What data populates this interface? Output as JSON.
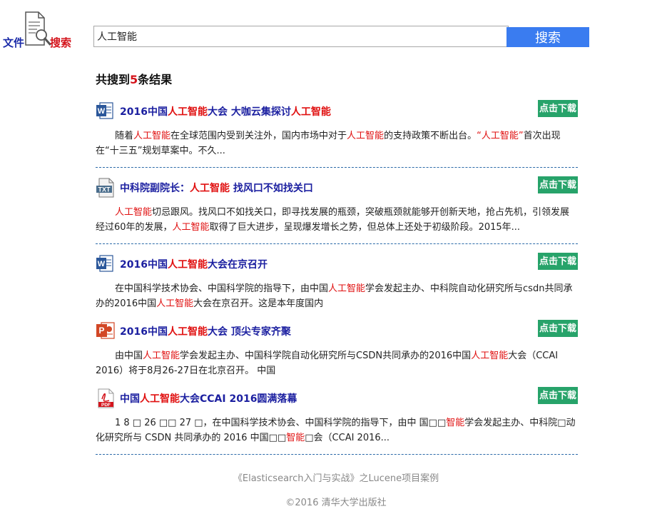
{
  "logo": {
    "left_text": "文件",
    "right_text": "搜索"
  },
  "search": {
    "value": "人工智能",
    "button_label": "搜索"
  },
  "summary": {
    "prefix": "共搜到",
    "count": "5",
    "suffix": "条结果"
  },
  "results": [
    {
      "filetype": "word-icon",
      "title": [
        {
          "t": "2016中国",
          "hl": false
        },
        {
          "t": "人工智能",
          "hl": true
        },
        {
          "t": "大会 大咖云集探讨",
          "hl": false
        },
        {
          "t": "人工智能",
          "hl": true
        }
      ],
      "download_label": "点击下载",
      "snippet": [
        {
          "t": "随着",
          "hl": false
        },
        {
          "t": "人工智能",
          "hl": true
        },
        {
          "t": "在全球范围内受到关注外，国内市场中对于",
          "hl": false
        },
        {
          "t": "人工智能",
          "hl": true
        },
        {
          "t": "的支持政策不断出台。",
          "hl": false
        },
        {
          "t": "“人工智能”",
          "hl": true
        },
        {
          "t": "首次出现在“十三五”规划草案中。不久...",
          "hl": false
        }
      ],
      "separator": true
    },
    {
      "filetype": "txt-icon",
      "title": [
        {
          "t": "中科院副院长：",
          "hl": false
        },
        {
          "t": "人工智能",
          "hl": true
        },
        {
          "t": " 找风口不如找关口",
          "hl": false
        }
      ],
      "download_label": "点击下载",
      "snippet": [
        {
          "t": "人工智能",
          "hl": true
        },
        {
          "t": "切忌跟风。找风口不如找关口，即寻找发展的瓶颈，突破瓶颈就能够开创新天地，抢占先机，引领发展 经过60年的发展，",
          "hl": false
        },
        {
          "t": "人工智能",
          "hl": true
        },
        {
          "t": "取得了巨大进步，呈现爆发增长之势，但总体上还处于初级阶段。2015年...",
          "hl": false
        }
      ],
      "separator": true
    },
    {
      "filetype": "word-icon",
      "title": [
        {
          "t": "2016中国",
          "hl": false
        },
        {
          "t": "人工智能",
          "hl": true
        },
        {
          "t": "大会在京召开",
          "hl": false
        }
      ],
      "download_label": "点击下载",
      "snippet": [
        {
          "t": "在中国科学技术协会、中国科学院的指导下，由中国",
          "hl": false
        },
        {
          "t": "人工智能",
          "hl": true
        },
        {
          "t": "学会发起主办、中科院自动化研究所与csdn共同承办的2016中国",
          "hl": false
        },
        {
          "t": "人工智能",
          "hl": true
        },
        {
          "t": "大会在京召开。这是本年度国内",
          "hl": false
        }
      ],
      "separator": false
    },
    {
      "filetype": "ppt-icon",
      "title": [
        {
          "t": "2016中国",
          "hl": false
        },
        {
          "t": "人工智能",
          "hl": true
        },
        {
          "t": "大会 顶尖专家齐聚",
          "hl": false
        }
      ],
      "download_label": "点击下载",
      "snippet": [
        {
          "t": "由中国",
          "hl": false
        },
        {
          "t": "人工智能",
          "hl": true
        },
        {
          "t": "学会发起主办、中国科学院自动化研究所与CSDN共同承办的2016中国",
          "hl": false
        },
        {
          "t": "人工智能",
          "hl": true
        },
        {
          "t": "大会（CCAI 2016）将于8月26-27日在北京召开。 中国",
          "hl": false
        }
      ],
      "separator": false
    },
    {
      "filetype": "pdf-icon",
      "title": [
        {
          "t": "中国",
          "hl": false
        },
        {
          "t": "人工智能",
          "hl": true
        },
        {
          "t": "大会CCAI 2016圆满落幕",
          "hl": false
        }
      ],
      "download_label": "点击下载",
      "snippet": [
        {
          "t": "1 8 □ 26 □□ 27 □，在中国科学技术协会、中国科学院的指导下，由中 国□□",
          "hl": false
        },
        {
          "t": "智能",
          "hl": true
        },
        {
          "t": "学会发起主办、中科院□动化研究所与 CSDN 共同承办的 2016 中国□□",
          "hl": false
        },
        {
          "t": "智能",
          "hl": true
        },
        {
          "t": "□会（CCAI 2016...",
          "hl": false
        }
      ],
      "separator": true
    }
  ],
  "footer": {
    "line1": "《Elasticsearch入门与实战》之Lucene项目案例",
    "line2": "©2016 清华大学出版社"
  },
  "colors": {
    "accent": "#3a7cf0",
    "highlight": "#e01010",
    "title": "#1b1fa0",
    "download": "#27a36a"
  }
}
